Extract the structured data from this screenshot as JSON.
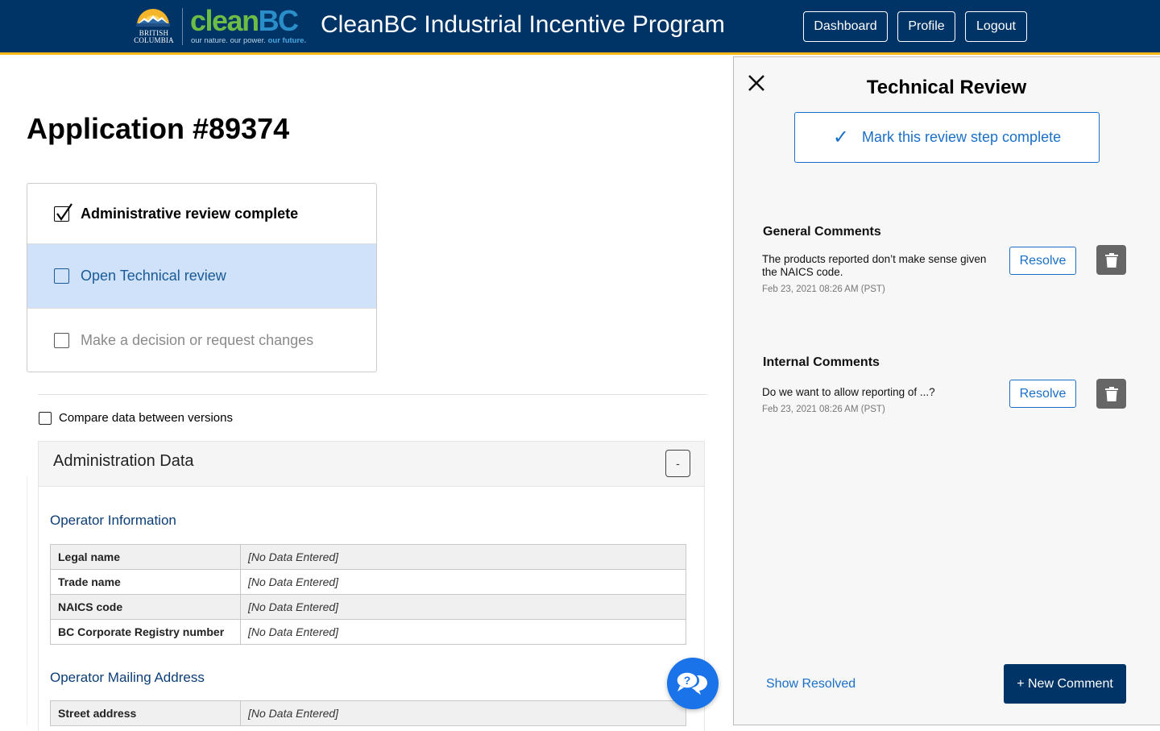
{
  "header": {
    "bc_logo_lines": [
      "British",
      "Columbia"
    ],
    "clean_logo": {
      "part1": "clean",
      "part2": "BC"
    },
    "tagline": {
      "plain": "our nature. our power.",
      "bold": "our future."
    },
    "app_title": "CleanBC Industrial Incentive Program",
    "nav": {
      "dashboard": "Dashboard",
      "profile": "Profile",
      "logout": "Logout"
    }
  },
  "main": {
    "page_title": "Application #89374",
    "review_steps": [
      {
        "label": "Administrative review complete",
        "checked": true,
        "state": "complete"
      },
      {
        "label": "Open Technical review",
        "checked": false,
        "state": "active"
      },
      {
        "label": "Make a decision or request changes",
        "checked": false,
        "state": "disabled"
      }
    ],
    "compare_label": "Compare data between versions",
    "compare_checked": false,
    "card": {
      "title": "Administration Data",
      "collapse_label": "-",
      "sections": [
        {
          "title": "Operator Information",
          "rows": [
            {
              "key": "Legal name",
              "value": "[No Data Entered]"
            },
            {
              "key": "Trade name",
              "value": "[No Data Entered]"
            },
            {
              "key": "NAICS code",
              "value": "[No Data Entered]"
            },
            {
              "key": "BC Corporate Registry number",
              "value": "[No Data Entered]"
            }
          ]
        },
        {
          "title": "Operator Mailing Address",
          "rows": [
            {
              "key": "Street address",
              "value": "[No Data Entered]"
            }
          ]
        }
      ]
    }
  },
  "panel": {
    "title": "Technical Review",
    "mark_complete_label": "Mark this review step complete",
    "general": {
      "heading": "General Comments",
      "comments": [
        {
          "text": "The products reported don’t make sense given the NAICS code.",
          "date": "Feb 23, 2021 08:26 AM (PST)",
          "resolve_label": "Resolve"
        }
      ]
    },
    "internal": {
      "heading": "Internal Comments",
      "comments": [
        {
          "text": "Do we want to allow reporting of ...?",
          "date": "Feb 23, 2021 08:26 AM (PST)",
          "resolve_label": "Resolve"
        }
      ]
    },
    "show_resolved_label": "Show Resolved",
    "new_comment_label": "+ New Comment"
  },
  "colors": {
    "header_bg": "#003366",
    "header_accent": "#fcba19",
    "link_blue": "#1a6fc8",
    "active_step_bg": "#cfe2fa",
    "help_bubble": "#1a73e8"
  }
}
